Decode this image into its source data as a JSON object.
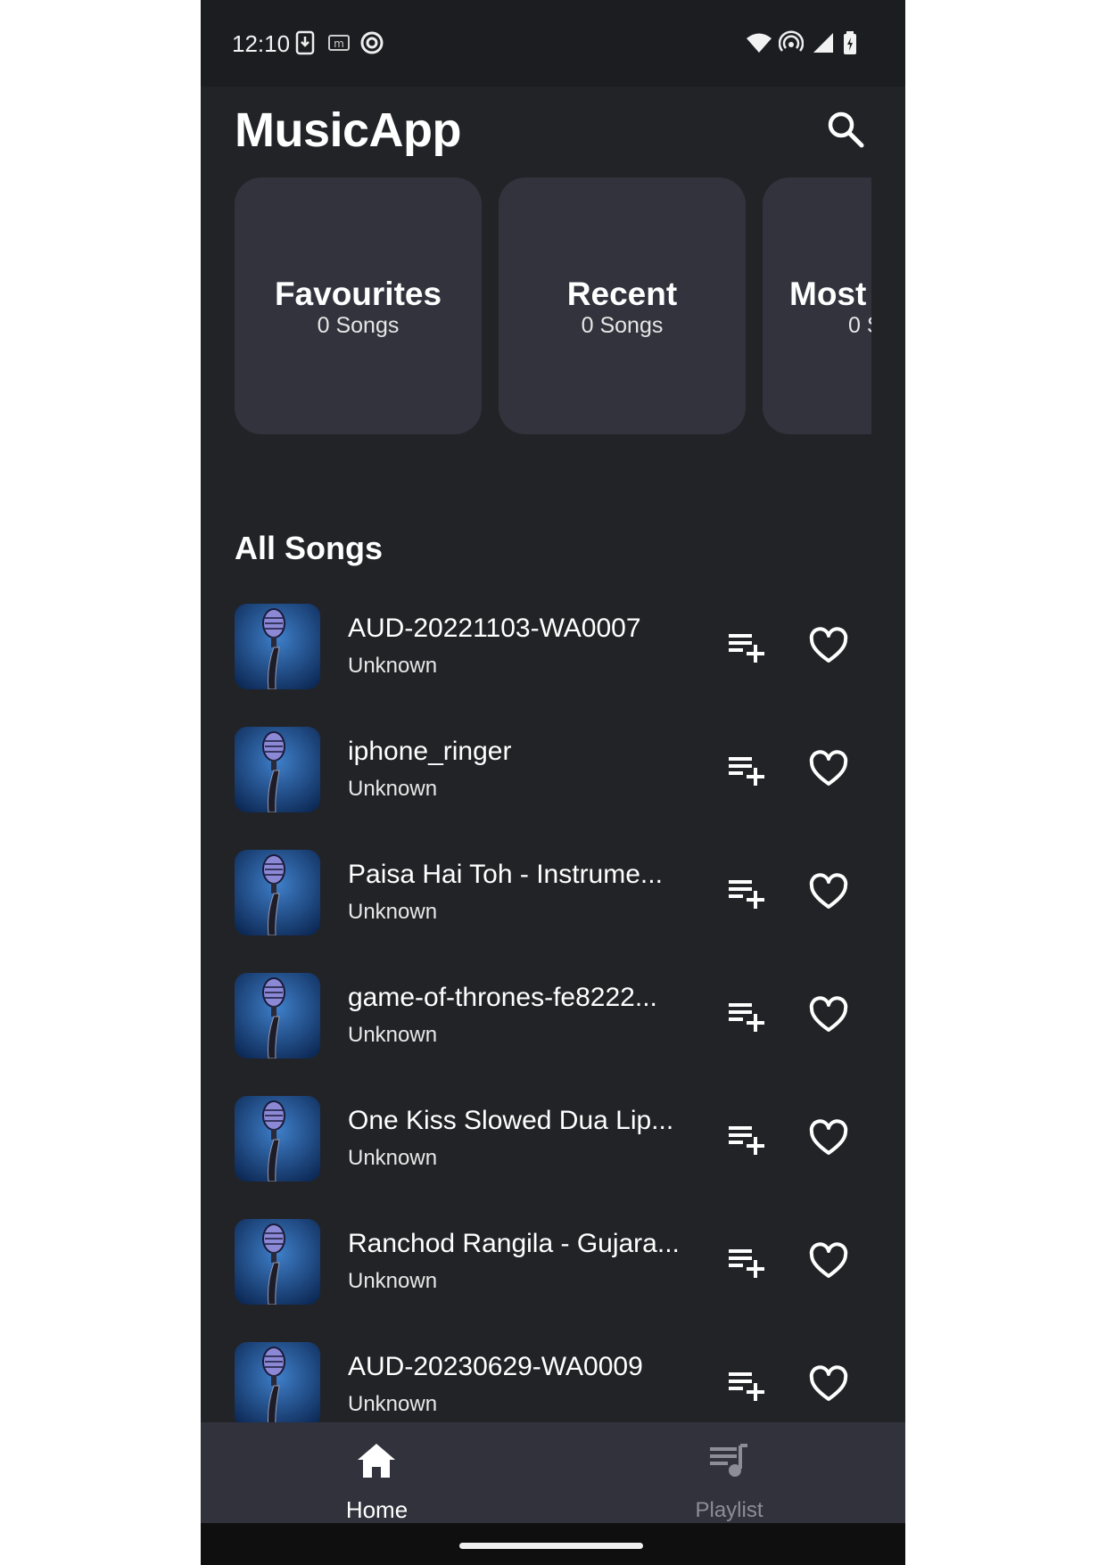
{
  "status_bar": {
    "time": "12:10",
    "left_icons": [
      "download-icon",
      "m-notification-icon",
      "sync-icon"
    ],
    "right_icons": [
      "wifi-icon",
      "hotspot-icon",
      "signal-icon",
      "battery-charging-icon"
    ]
  },
  "header": {
    "title": "MusicApp",
    "search_icon": "search-icon"
  },
  "cards": [
    {
      "title": "Favourites",
      "count": "0 Songs"
    },
    {
      "title": "Recent",
      "count": "0 Songs"
    },
    {
      "title": "Most",
      "count": "0 S"
    }
  ],
  "section_title": "All Songs",
  "songs": [
    {
      "title": "AUD-20221103-WA0007",
      "artist": "Unknown"
    },
    {
      "title": "iphone_ringer",
      "artist": "Unknown"
    },
    {
      "title": "Paisa Hai Toh - Instrume...",
      "artist": "Unknown"
    },
    {
      "title": "game-of-thrones-fe8222...",
      "artist": "Unknown"
    },
    {
      "title": "One Kiss Slowed Dua Lip...",
      "artist": "Unknown"
    },
    {
      "title": "Ranchod Rangila - Gujara...",
      "artist": "Unknown"
    },
    {
      "title": "AUD-20230629-WA0009",
      "artist": "Unknown"
    }
  ],
  "bottom_nav": {
    "home": "Home",
    "playlist": "Playlist",
    "active": "home"
  },
  "colors": {
    "background": "#222327",
    "card": "#32333d",
    "nav": "#31323c",
    "inactive": "#8c8d96"
  }
}
